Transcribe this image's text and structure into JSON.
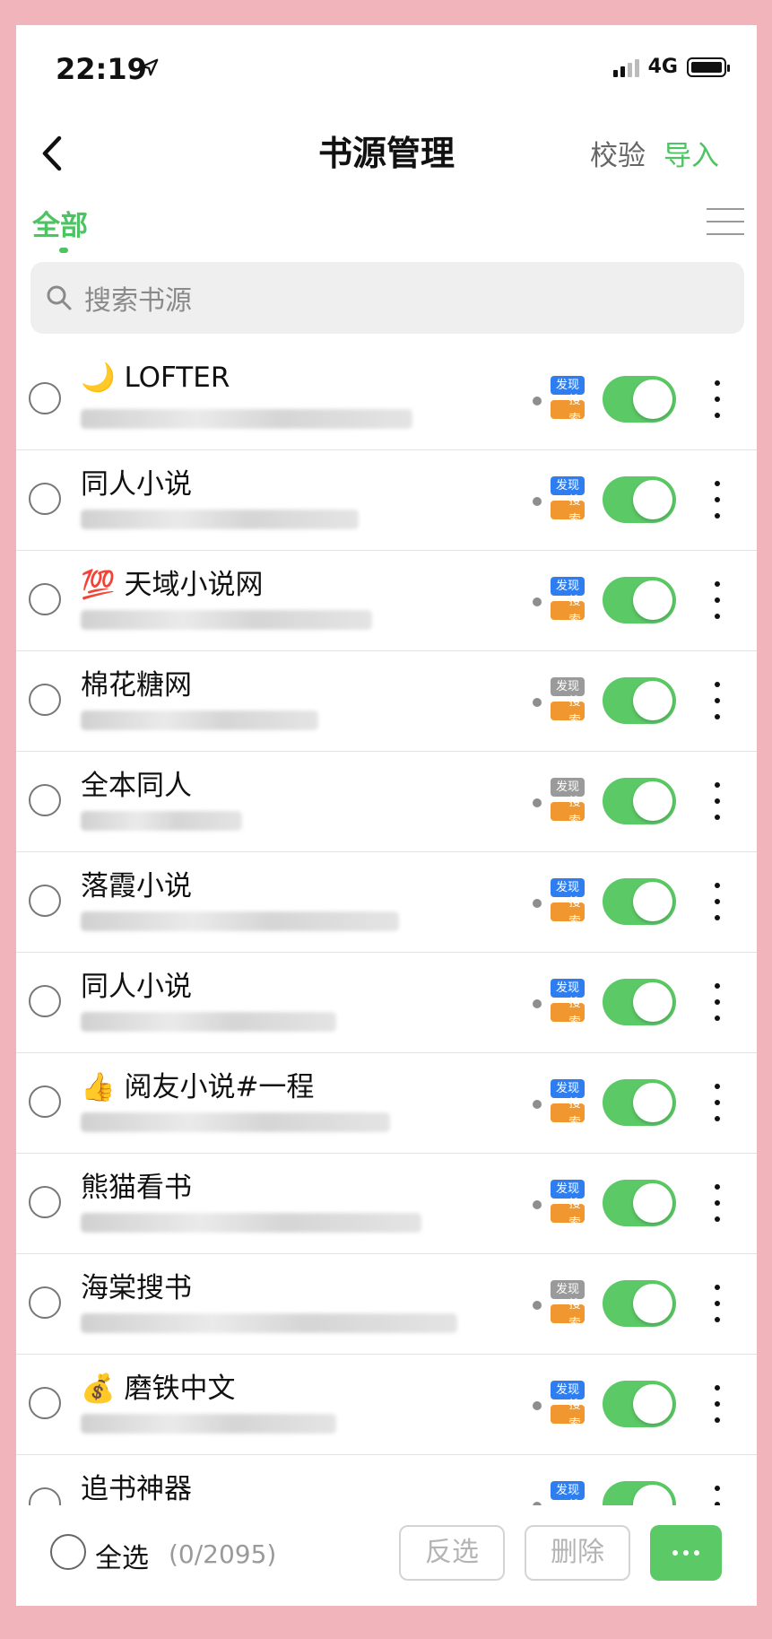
{
  "status_bar": {
    "time": "22:19",
    "network": "4G"
  },
  "nav": {
    "title": "书源管理",
    "verify_label": "校验",
    "import_label": "导入"
  },
  "tabs": [
    {
      "label": "全部",
      "active": true
    }
  ],
  "search": {
    "placeholder": "搜索书源"
  },
  "colors": {
    "accent": "#4cc462",
    "toggle_on": "#5bc966",
    "badge_discover_active": "#2f7ef0",
    "badge_discover_inactive": "#9a9a9a",
    "badge_search": "#f0972f"
  },
  "badge_labels": {
    "discover": "发现",
    "search": "搜索"
  },
  "sources": [
    {
      "name": "🌙 LOFTER",
      "discover_active": true,
      "enabled": true
    },
    {
      "name": "同人小说",
      "discover_active": true,
      "enabled": true
    },
    {
      "name": "💯 天域小说网",
      "discover_active": true,
      "enabled": true
    },
    {
      "name": "棉花糖网",
      "discover_active": false,
      "enabled": true
    },
    {
      "name": "全本同人",
      "discover_active": false,
      "enabled": true
    },
    {
      "name": "落霞小说",
      "discover_active": true,
      "enabled": true
    },
    {
      "name": "同人小说",
      "discover_active": true,
      "enabled": true
    },
    {
      "name": "👍 阅友小说#一程",
      "discover_active": true,
      "enabled": true
    },
    {
      "name": "熊猫看书",
      "discover_active": true,
      "enabled": true
    },
    {
      "name": "海棠搜书",
      "discover_active": false,
      "enabled": true
    },
    {
      "name": "💰 磨铁中文",
      "discover_active": true,
      "enabled": true
    },
    {
      "name": "追书神器",
      "discover_active": true,
      "enabled": true
    }
  ],
  "bottom_bar": {
    "select_all_label": "全选",
    "selection_count": "(0/2095)",
    "invert_label": "反选",
    "delete_label": "删除"
  }
}
